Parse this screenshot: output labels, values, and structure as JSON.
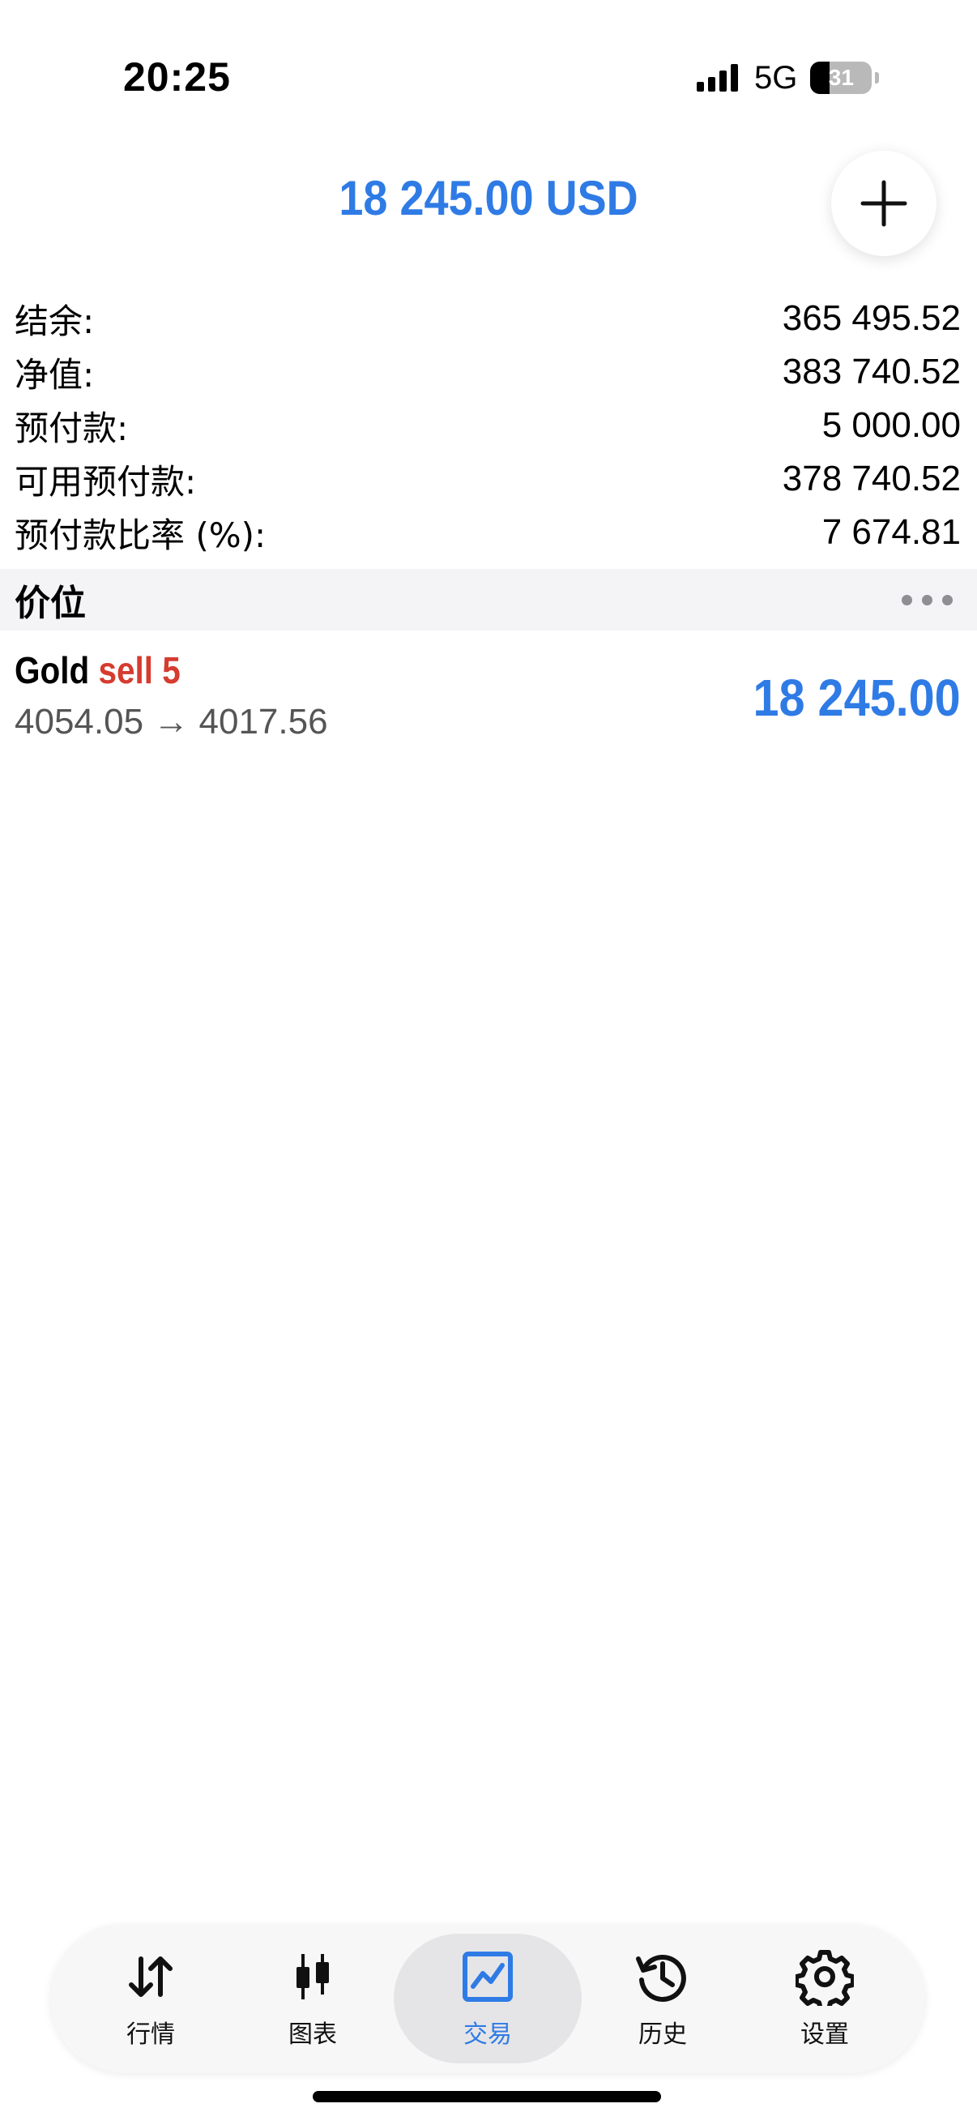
{
  "status_bar": {
    "time": "20:25",
    "network": "5G",
    "battery_level": "31",
    "battery_fraction": 0.31,
    "signal_bars": 4
  },
  "header": {
    "balance_title": "18 245.00 USD",
    "add_icon": "plus-icon"
  },
  "summary": [
    {
      "label": "结余:",
      "value": "365 495.52"
    },
    {
      "label": "净值:",
      "value": "383 740.52"
    },
    {
      "label": "预付款:",
      "value": "5 000.00"
    },
    {
      "label": "可用预付款:",
      "value": "378 740.52"
    },
    {
      "label": "预付款比率 (%):",
      "value": "7 674.81"
    }
  ],
  "positions_section": {
    "title": "价位",
    "more_icon": "more-dots-icon"
  },
  "position": {
    "symbol": "Gold",
    "type_volume": "sell 5",
    "prices": "4054.05 → 4017.56",
    "profit": "18 245.00"
  },
  "tabs": [
    {
      "label": "行情",
      "icon": "arrows-up-down-icon",
      "active": false
    },
    {
      "label": "图表",
      "icon": "candlestick-icon",
      "active": false
    },
    {
      "label": "交易",
      "icon": "trade-chart-icon",
      "active": true
    },
    {
      "label": "历史",
      "icon": "history-icon",
      "active": false
    },
    {
      "label": "设置",
      "icon": "gear-icon",
      "active": false
    }
  ],
  "colors": {
    "accent": "#2f7be5",
    "sell": "#d63b2f",
    "section_bg": "#f4f4f6"
  }
}
